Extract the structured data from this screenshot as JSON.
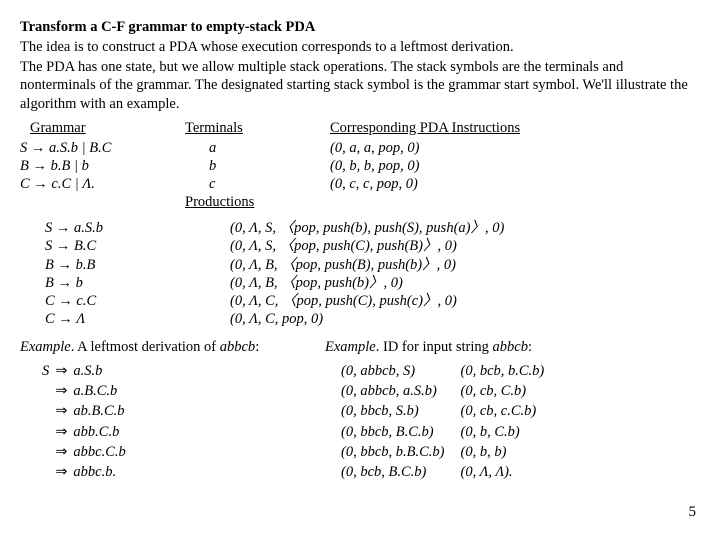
{
  "title": "Transform a C-F grammar to empty-stack PDA",
  "intro1": "The idea is to construct a PDA whose execution corresponds to a leftmost derivation.",
  "intro2": "The PDA has one state, but we allow multiple stack operations. The stack symbols are the terminals and nonterminals of the grammar. The designated starting stack symbol is the grammar start symbol. We'll illustrate the algorithm with an example.",
  "headers": {
    "grammar": "Grammar",
    "terminals": "Terminals",
    "instructions": "Corresponding PDA Instructions",
    "productions": "Productions"
  },
  "grammar": [
    {
      "lhs": "S",
      "rhs": "a.S.b | B.C"
    },
    {
      "lhs": "B",
      "rhs": "b.B | b"
    },
    {
      "lhs": "C",
      "rhs": "c.C | Λ."
    }
  ],
  "terminals": [
    "a",
    "b",
    "c"
  ],
  "term_instr": [
    "(0, a, a, pop, 0)",
    "(0, b, b, pop, 0)",
    "(0, c, c, pop, 0)"
  ],
  "productions": [
    {
      "p": "S → a.S.b",
      "i": "(0, Λ, S, 〈pop, push(b), push(S), push(a)〉, 0)"
    },
    {
      "p": "S → B.C",
      "i": "(0, Λ, S, 〈pop, push(C), push(B)〉, 0)"
    },
    {
      "p": "B → b.B",
      "i": "(0, Λ, B, 〈pop, push(B), push(b)〉, 0)"
    },
    {
      "p": "B → b",
      "i": "(0, Λ, B, 〈pop, push(b)〉, 0)"
    },
    {
      "p": "C → c.C",
      "i": "(0, Λ, C, 〈pop, push(C), push(c)〉, 0)"
    },
    {
      "p": "C → Λ",
      "i": "(0, Λ, C, pop, 0)"
    }
  ],
  "example_left_title_pre": "Example",
  "example_left_title_mid": ". A leftmost derivation of ",
  "example_left_title_obj": "abbcb",
  "example_left_title_post": ":",
  "derivation": [
    {
      "lhs": "S",
      "arr": "⇒",
      "rhs": "a.S.b"
    },
    {
      "lhs": "",
      "arr": "⇒",
      "rhs": "a.B.C.b"
    },
    {
      "lhs": "",
      "arr": "⇒",
      "rhs": "ab.B.C.b"
    },
    {
      "lhs": "",
      "arr": "⇒",
      "rhs": "abb.C.b"
    },
    {
      "lhs": "",
      "arr": "⇒",
      "rhs": "abbc.C.b"
    },
    {
      "lhs": "",
      "arr": "⇒",
      "rhs": "abbc.b."
    }
  ],
  "example_right_title_pre": "Example",
  "example_right_title_mid": ". ID for input string ",
  "example_right_title_obj": "abbcb",
  "example_right_title_post": ":",
  "ids_left": [
    "(0, abbcb, S)",
    "(0, abbcb, a.S.b)",
    "(0, bbcb, S.b)",
    "(0, bbcb, B.C.b)",
    "(0, bbcb, b.B.C.b)",
    "(0, bcb, B.C.b)"
  ],
  "ids_right": [
    "(0, bcb, b.C.b)",
    "(0, cb, C.b)",
    "(0, cb, c.C.b)",
    "(0, b, C.b)",
    "(0, b, b)",
    "(0, Λ, Λ)."
  ],
  "page_number": "5"
}
